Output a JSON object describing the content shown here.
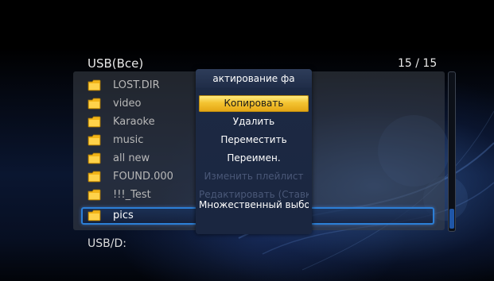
{
  "header": {
    "title": "USB(Все)",
    "count": "15 / 15"
  },
  "file_list": {
    "items": [
      {
        "label": "LOST.DIR",
        "icon": "folder-icon"
      },
      {
        "label": "video",
        "icon": "folder-icon"
      },
      {
        "label": "Karaoke",
        "icon": "folder-icon"
      },
      {
        "label": "music",
        "icon": "folder-icon"
      },
      {
        "label": "all new",
        "icon": "folder-icon"
      },
      {
        "label": "FOUND.000",
        "icon": "folder-icon"
      },
      {
        "label": "!!!_Test",
        "icon": "folder-icon"
      },
      {
        "label": "pics",
        "icon": "folder-icon",
        "selected": true
      }
    ]
  },
  "footer": {
    "path": "USB/D:"
  },
  "context_menu": {
    "title": "актирование фа",
    "items": [
      {
        "label": "Копировать",
        "state": "highlighted"
      },
      {
        "label": "Удалить",
        "state": "enabled"
      },
      {
        "label": "Переместить",
        "state": "enabled"
      },
      {
        "label": "Переимен.",
        "state": "enabled"
      },
      {
        "label": "Изменить плейлист",
        "state": "disabled"
      },
      {
        "label": "Редактировать (Ставка)",
        "state": "disabled"
      },
      {
        "label": "Множественный выбор",
        "state": "enabled"
      }
    ]
  },
  "colors": {
    "highlight": "#f4c432",
    "selection_border": "#2c7fd6",
    "folder": "#f2b418",
    "menu_bg": "#1d2a44"
  }
}
